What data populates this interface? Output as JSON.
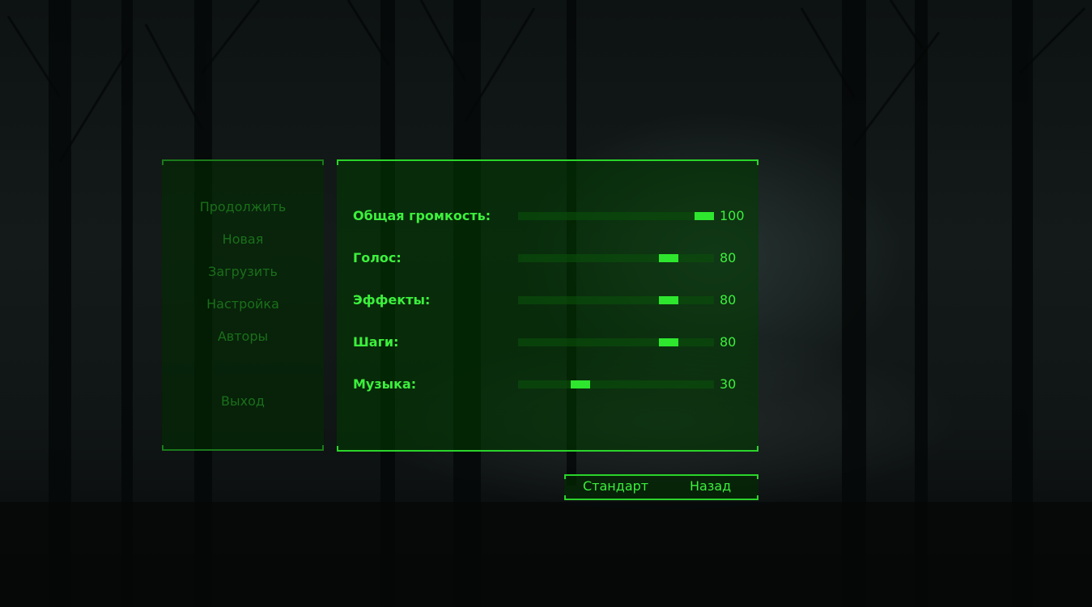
{
  "menu": {
    "items": [
      {
        "label": "Продолжить"
      },
      {
        "label": "Новая"
      },
      {
        "label": "Загрузить"
      },
      {
        "label": "Настройка"
      },
      {
        "label": "Авторы"
      },
      {
        "label": "Выход"
      }
    ]
  },
  "audio_settings": [
    {
      "label": "Общая громкость:",
      "value": "100",
      "level": 100
    },
    {
      "label": "Голос:",
      "value": "80",
      "level": 80
    },
    {
      "label": "Эффекты:",
      "value": "80",
      "level": 80
    },
    {
      "label": "Шаги:",
      "value": "80",
      "level": 80
    },
    {
      "label": "Музыка:",
      "value": "30",
      "level": 30
    }
  ],
  "buttons": {
    "default_label": "Стандарт",
    "back_label": "Назад"
  },
  "colors": {
    "accent": "#2ee62e",
    "text": "#3cf03c",
    "menu_text_dim": "#1a6f1a",
    "panel_bg": "#003c00"
  }
}
